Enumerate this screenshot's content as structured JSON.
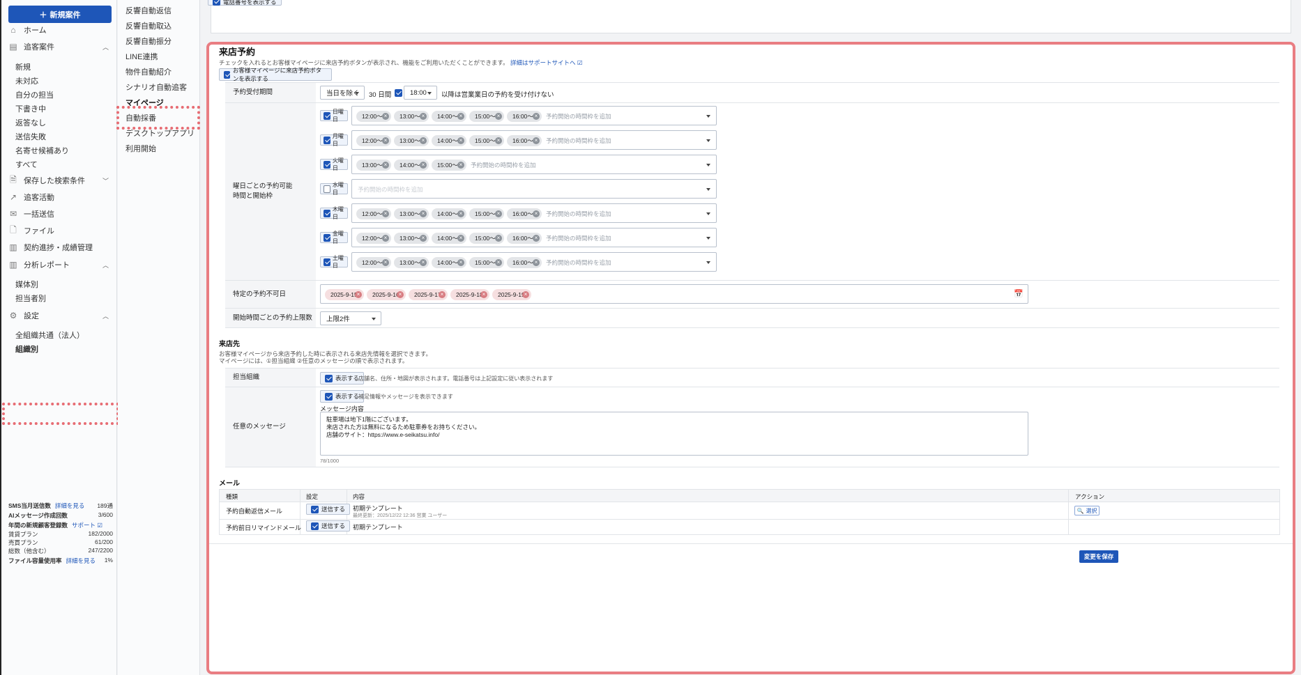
{
  "leftnav": {
    "new_button": "新規案件",
    "home": "ホーム",
    "tracking": "追客案件",
    "tracking_sub": [
      "新規",
      "未対応",
      "自分の担当",
      "下書き中",
      "返答なし",
      "送信失敗",
      "名寄せ候補あり",
      "すべて"
    ],
    "saved_search": "保存した検索条件",
    "activity": "追客活動",
    "bulk_send": "一括送信",
    "files": "ファイル",
    "contract": "契約進捗・成績管理",
    "report": "分析レポート",
    "report_sub": [
      "媒体別",
      "担当者別"
    ],
    "settings": "設定",
    "settings_sub": [
      "全組織共通（法人）",
      "組織別"
    ],
    "stats": {
      "sms_label": "SMS当月送信数",
      "sms_link": "詳細を見る",
      "sms_value": "189通",
      "ai_label": "AIメッセージ作成回数",
      "ai_value": "3/600",
      "annual_label": "年間の新規顧客登録数",
      "annual_link": "サポート ☑",
      "rent_label": "賃貸プラン",
      "rent_value": "182/2000",
      "sale_label": "売買プラン",
      "sale_value": "61/200",
      "total_label": "総数（他含む）",
      "total_value": "247/2200",
      "file_label": "ファイル容量使用率",
      "file_link": "詳細を見る",
      "file_value": "1%"
    }
  },
  "subnav": {
    "items": [
      "反響自動返信",
      "反響自動取込",
      "反響自動振分",
      "LINE連携",
      "物件自動紹介",
      "シナリオ自動追客",
      "マイページ",
      "自動採番",
      "デスクトップアプリ",
      "利用開始"
    ]
  },
  "top_card": {
    "checkbox_label": "電話番号を表示する"
  },
  "reservation": {
    "title": "来店予約",
    "description": "チェックを入れるとお客様マイページに来店予約ボタンが表示され、機能をご利用いただくことができます。",
    "support_link": "詳細はサポートサイトへ ☑",
    "show_button_label": "お客様マイページに来店予約ボタンを表示する",
    "period_label": "予約受付期間",
    "period_select": "当日を除く",
    "period_days": "30 日間",
    "time_select": "18:00",
    "period_suffix": "以降は営業業日の予約を受け付けない",
    "weekday_label_1": "曜日ごとの予約可能",
    "weekday_label_2": "時間と開始枠",
    "placeholder": "予約開始の時間枠を追加",
    "days": [
      {
        "name": "日曜日",
        "checked": true,
        "slots": [
          "12:00〜",
          "13:00〜",
          "14:00〜",
          "15:00〜",
          "16:00〜"
        ]
      },
      {
        "name": "月曜日",
        "checked": true,
        "slots": [
          "12:00〜",
          "13:00〜",
          "14:00〜",
          "15:00〜",
          "16:00〜"
        ]
      },
      {
        "name": "火曜日",
        "checked": true,
        "slots": [
          "13:00〜",
          "14:00〜",
          "15:00〜"
        ]
      },
      {
        "name": "水曜日",
        "checked": false,
        "slots": []
      },
      {
        "name": "木曜日",
        "checked": true,
        "slots": [
          "12:00〜",
          "13:00〜",
          "14:00〜",
          "15:00〜",
          "16:00〜"
        ]
      },
      {
        "name": "金曜日",
        "checked": true,
        "slots": [
          "12:00〜",
          "13:00〜",
          "14:00〜",
          "15:00〜",
          "16:00〜"
        ]
      },
      {
        "name": "土曜日",
        "checked": true,
        "slots": [
          "12:00〜",
          "13:00〜",
          "14:00〜",
          "15:00〜",
          "16:00〜"
        ]
      }
    ],
    "unavailable_label": "特定の予約不可日",
    "unavailable_dates": [
      "2025-9-15",
      "2025-9-16",
      "2025-9-17",
      "2025-9-18",
      "2025-9-19"
    ],
    "limit_label": "開始時間ごとの予約上限数",
    "limit_select": "上限2件"
  },
  "destination": {
    "title": "来店先",
    "desc1": "お客様マイページから来店予約した時に表示される来店先情報を選択できます。",
    "desc2": "マイページには、①担当組織 ②任意のメッセージの順で表示されます。",
    "org_label": "担当組織",
    "show_label": "表示する",
    "org_note": "店舗名、住所・地図が表示されます。電話番号は上記設定に従い表示されます",
    "msg_label": "任意のメッセージ",
    "msg_note": "補足情報やメッセージを表示できます",
    "msg_content_label": "メッセージ内容",
    "msg_lines": [
      "駐車場は地下1階にございます。",
      "来店された方は無料になるため駐車券をお持ちください。",
      "店舗のサイト：https://www.e-seikatsu.info/"
    ],
    "counter": "78/1000"
  },
  "mail": {
    "title": "メール",
    "headers": {
      "type": "種類",
      "setting": "設定",
      "content": "内容",
      "action": "アクション"
    },
    "rows": [
      {
        "type": "予約自動返信メール",
        "send": "送信する",
        "content": "初期テンプレート",
        "meta": "最終更新：2025/12/22 12:36 営業 ユーザー",
        "action": "選択"
      },
      {
        "type": "予約前日リマインドメール",
        "send": "送信する",
        "content": "初期テンプレート",
        "meta": "",
        "action": ""
      }
    ]
  },
  "save_button": "変更を保存",
  "colors": {
    "primary": "#1e56b8",
    "highlight": "#e76c73"
  }
}
